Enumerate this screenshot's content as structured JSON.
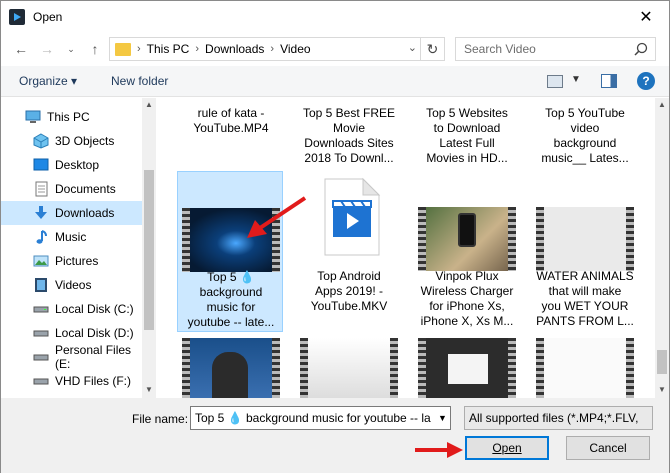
{
  "window": {
    "title": "Open",
    "close_glyph": "✕"
  },
  "address": {
    "crumbs": [
      "This PC",
      "Downloads",
      "Video"
    ],
    "search_placeholder": "Search Video"
  },
  "toolbar": {
    "organize_label": "Organize ▾",
    "new_folder_label": "New folder",
    "help_label": "?"
  },
  "nav": {
    "items": [
      {
        "label": "This PC",
        "icon": "computer-icon"
      },
      {
        "label": "3D Objects",
        "icon": "cube-icon"
      },
      {
        "label": "Desktop",
        "icon": "desktop-icon"
      },
      {
        "label": "Documents",
        "icon": "documents-icon"
      },
      {
        "label": "Downloads",
        "icon": "download-arrow-icon",
        "selected": true
      },
      {
        "label": "Music",
        "icon": "music-note-icon"
      },
      {
        "label": "Pictures",
        "icon": "pictures-icon"
      },
      {
        "label": "Videos",
        "icon": "video-film-icon"
      },
      {
        "label": "Local Disk (C:)",
        "icon": "drive-icon"
      },
      {
        "label": "Local Disk (D:)",
        "icon": "drive-icon"
      },
      {
        "label": "Personal Files (E:",
        "icon": "drive-icon"
      },
      {
        "label": "VHD Files (F:)",
        "icon": "drive-icon"
      }
    ]
  },
  "files": {
    "row1": [
      {
        "label": [
          "rule of kata -",
          "YouTube.MP4"
        ]
      },
      {
        "label": [
          "Top 5 Best FREE",
          "Movie",
          "Downloads Sites",
          "2018 To Downl..."
        ]
      },
      {
        "label": [
          "Top 5 Websites",
          "to Download",
          "Latest Full",
          "Movies in HD..."
        ]
      },
      {
        "label": [
          "Top 5 YouTube",
          "video",
          "background",
          "music__ Lates..."
        ]
      }
    ],
    "row2": [
      {
        "label": [
          "Top 5 💧",
          "background",
          "music for",
          "youtube -- late..."
        ],
        "selected": true
      },
      {
        "label": [
          "Top Android",
          "Apps 2019! -",
          "YouTube.MKV"
        ]
      },
      {
        "label": [
          "Vinpok Plux",
          "Wireless Charger",
          "for iPhone Xs,",
          "iPhone X, Xs M..."
        ]
      },
      {
        "label": [
          "WATER ANIMALS",
          "that will make",
          "you WET YOUR",
          "PANTS FROM L..."
        ]
      }
    ]
  },
  "bottom": {
    "filename_label": "File name:",
    "filename_value": "Top 5 💧 background music for youtube -- la",
    "filetype_value": "All supported files (*.MP4;*.FLV,",
    "open_label": "Open",
    "cancel_label": "Cancel"
  },
  "colors": {
    "accent": "#0078d7",
    "selection": "#cce8ff",
    "arrow": "#e11b1b"
  }
}
